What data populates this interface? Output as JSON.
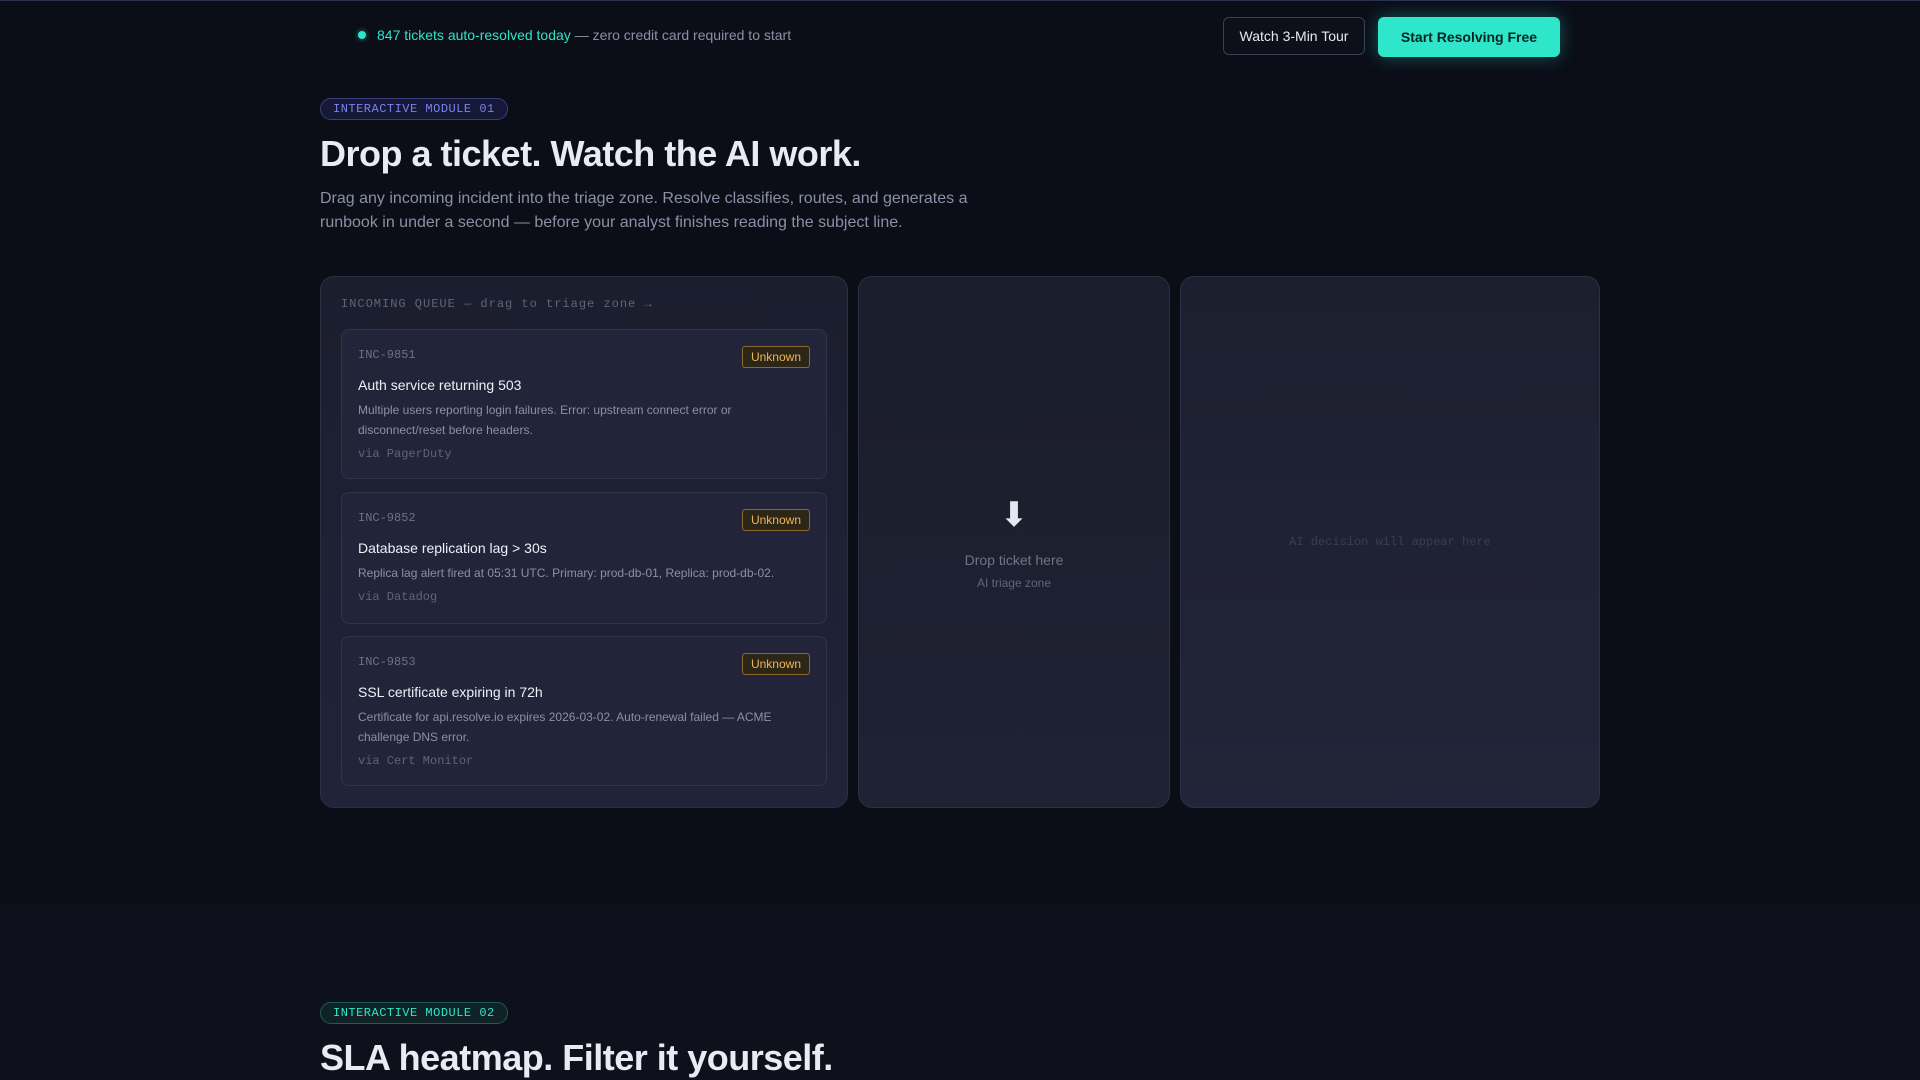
{
  "topbar": {
    "promo_highlight": "847 tickets auto-resolved today",
    "promo_rest": "— zero credit card required to start",
    "tour_button": "Watch 3-Min Tour",
    "start_button": "Start Resolving Free"
  },
  "module1": {
    "badge": "INTERACTIVE MODULE 01",
    "title": "Drop a ticket. Watch the AI work.",
    "lead": "Drag any incoming incident into the triage zone. Resolve classifies, routes, and generates a runbook in under a second — before your analyst finishes reading the subject line.",
    "queue_title": "INCOMING QUEUE — drag to triage zone →",
    "tickets": [
      {
        "id": "INC-9851",
        "status": "Unknown",
        "title": "Auth service returning 503",
        "description": "Multiple users reporting login failures. Error: upstream connect error or disconnect/reset before headers.",
        "source": "via PagerDuty"
      },
      {
        "id": "INC-9852",
        "status": "Unknown",
        "title": "Database replication lag > 30s",
        "description": "Replica lag alert fired at 05:31 UTC. Primary: prod-db-01, Replica: prod-db-02.",
        "source": "via Datadog"
      },
      {
        "id": "INC-9853",
        "status": "Unknown",
        "title": "SSL certificate expiring in 72h",
        "description": "Certificate for api.resolve.io expires 2026-03-02. Auto-renewal failed — ACME challenge DNS error.",
        "source": "via Cert Monitor"
      }
    ],
    "drop_zone": {
      "icon": "⬇",
      "label": "Drop ticket here",
      "sublabel": "AI triage zone"
    },
    "ai_placeholder": "AI decision will appear here"
  },
  "module2": {
    "badge": "INTERACTIVE MODULE 02",
    "title": "SLA heatmap. Filter it yourself."
  },
  "colors": {
    "accent": "#2ee6c9",
    "indigo": "#7b82f0",
    "warning": "#f0b45a",
    "background": "#0b0d17"
  }
}
